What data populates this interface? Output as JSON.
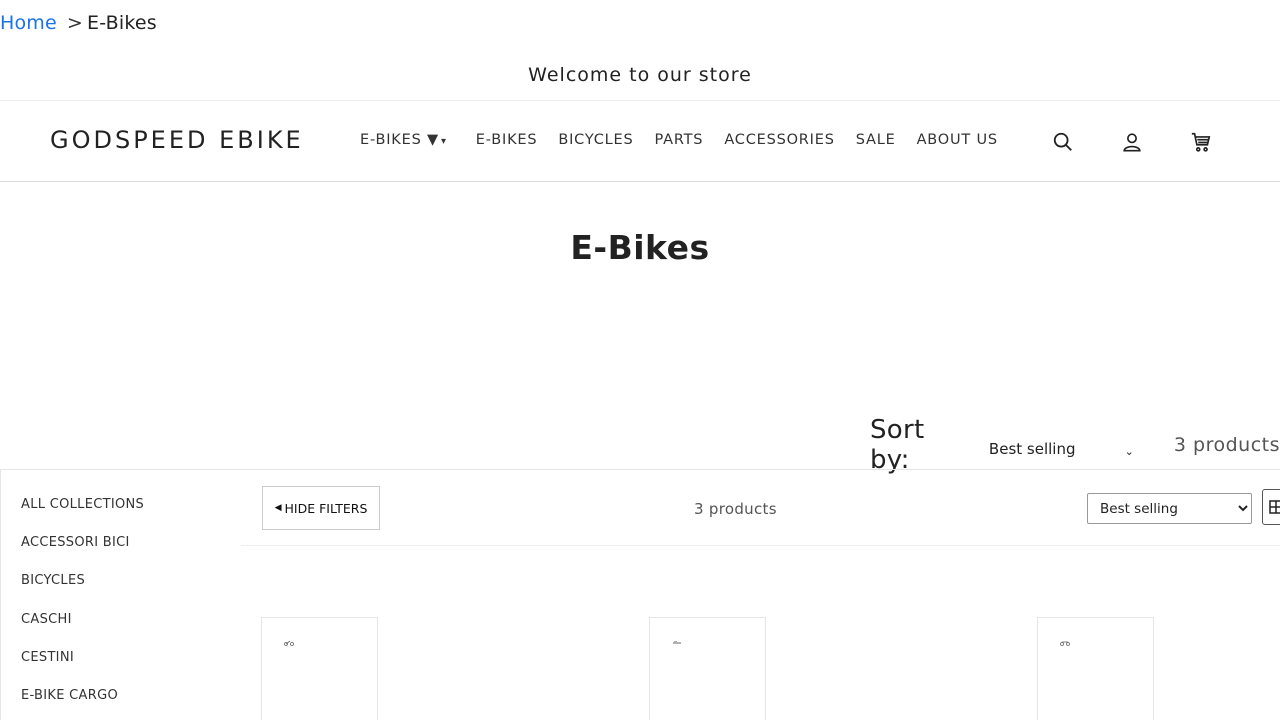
{
  "breadcrumb": {
    "home": "Home",
    "separator": ">",
    "current": "E-Bikes"
  },
  "announcement": "Welcome to our store",
  "header": {
    "logo": "GODSPEED EBIKE",
    "nav": {
      "dropdown": "E-BIKES ▼",
      "dropdown_arrow": "▾",
      "items": [
        "E-BIKES",
        "BICYCLES",
        "PARTS",
        "ACCESSORIES",
        "SALE",
        "ABOUT US"
      ]
    },
    "icons": [
      "search-icon",
      "account-icon",
      "cart-icon"
    ]
  },
  "page_title": "E-Bikes",
  "sort": {
    "label": "Sort by:",
    "selected": "Best selling",
    "count": "3 products"
  },
  "sidebar": {
    "categories": [
      "ALL COLLECTIONS",
      "ACCESSORI BICI",
      "BICYCLES",
      "CASCHI",
      "CESTINI",
      "E-BIKE CARGO"
    ]
  },
  "toolbar": {
    "hide_filters": "HIDE FILTERS",
    "count": "3 products",
    "sort_selected": "Best selling"
  },
  "products": [
    {},
    {},
    {}
  ]
}
